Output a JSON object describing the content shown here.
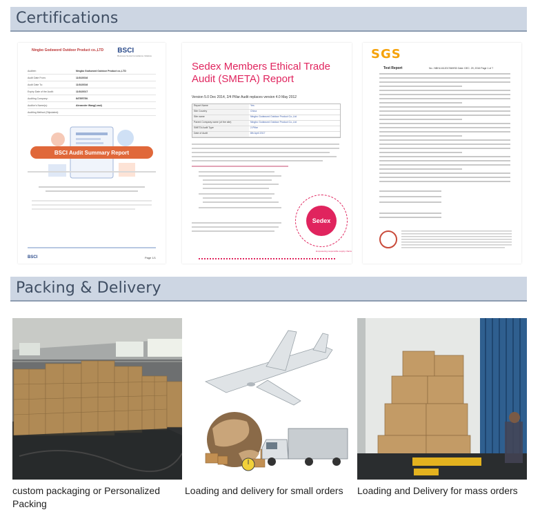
{
  "sections": {
    "certifications": "Certifications",
    "packing": "Packing & Delivery"
  },
  "certificates": {
    "bsci": {
      "company": "Ningbo Godsword Outdoor Product co.,LTD",
      "logo": "BSCI",
      "logo_sub": "Business Social Compliance Initiative",
      "rows": [
        {
          "k": "Auditee:",
          "v": "Ningbo Godsword Outdoor Product co.,LTD"
        },
        {
          "k": "Audit Date From:",
          "v": "11/02/2016"
        },
        {
          "k": "Audit Date To:",
          "v": "11/02/2016"
        },
        {
          "k": "Expiry Date of the Audit:",
          "v": "11/02/2017"
        },
        {
          "k": "Auditing Company:",
          "v": "INTERTEK"
        },
        {
          "k": "Auditor's Name(s):",
          "v": "Alexander Wang(Lead)"
        },
        {
          "k": "Auditing Method (Stipulated):",
          "v": ""
        }
      ],
      "banner": "BSCI Audit Summary Report",
      "footer_logo": "BSCI",
      "page": "Page 1/1"
    },
    "smeta": {
      "title": "Sedex Members Ethical Trade Audit (SMETA) Report",
      "version": "Version 5.0 Dec 2014, 2/4 Pillar Audit replaces version 4.0 May 2012",
      "rows": [
        {
          "k": "Report Name",
          "v": "Yes"
        },
        {
          "k": "Site Country",
          "v": "China"
        },
        {
          "k": "Site name",
          "v": "Ningbo Godsword Outdoor Product Co.,Ltd"
        },
        {
          "k": "Parent Company name (of the site)",
          "v": "Ningbo Godsword Outdoor Product Co.,Ltd"
        },
        {
          "k": "SMETA Audit Type",
          "v": "2-Pillar"
        },
        {
          "k": "Date of Audit",
          "v": "8th April 2017"
        }
      ],
      "badge": "Sedex",
      "ring_text": "Empowering responsible supply chains"
    },
    "sgs": {
      "logo": "SGS",
      "report_label": "Test Report",
      "report_no": "No.: NBHL1612017669SD   Date: DEC. 29, 2016   Page 1 of 7"
    }
  },
  "packing": {
    "items": [
      {
        "caption": "custom packaging or Personalized Packing"
      },
      {
        "caption": "Loading and delivery for small orders"
      },
      {
        "caption": "Loading and Delivery for mass orders"
      }
    ]
  },
  "colors": {
    "header_bg": "#cdd6e3",
    "header_text": "#3f4e63",
    "sedex_pink": "#e0245e",
    "bsci_orange": "#e0683a",
    "sgs_orange": "#f5a20a"
  }
}
